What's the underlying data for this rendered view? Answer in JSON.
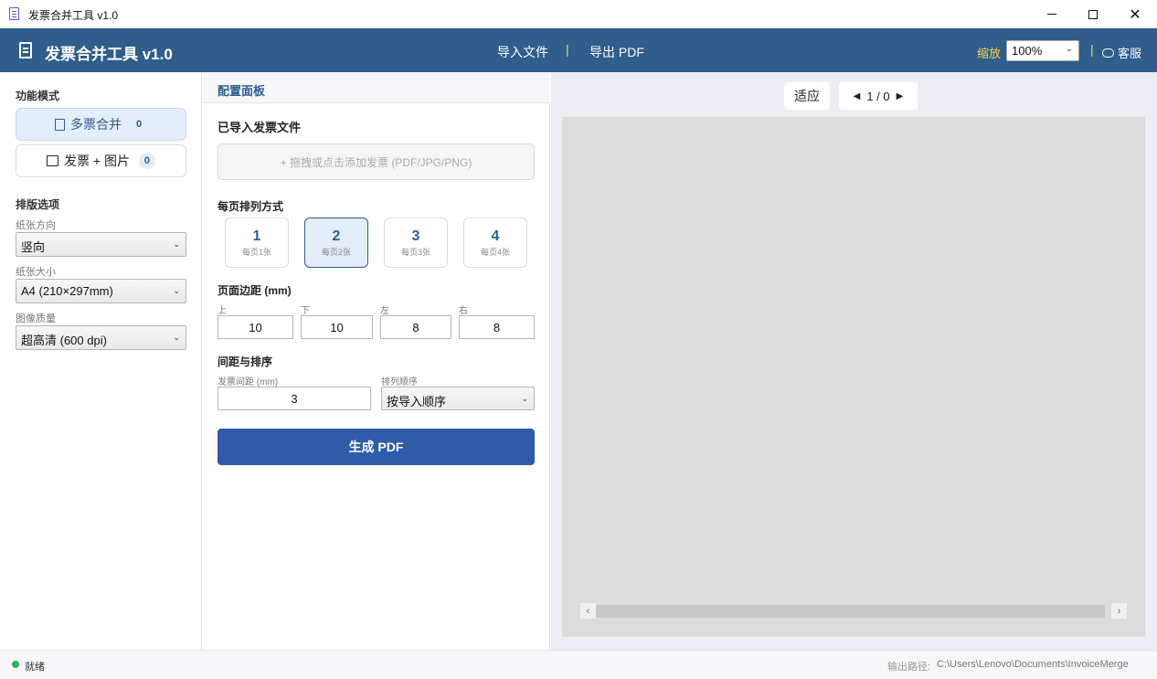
{
  "window": {
    "title": "发票合并工具 v1.0"
  },
  "header": {
    "app_title": "发票合并工具 v1.0",
    "nav_import": "导入文件",
    "nav_separator": "|",
    "nav_export": "导出 PDF",
    "zoom_label": "缩放",
    "zoom_value": "100%",
    "support_label": "客服"
  },
  "sidebar": {
    "mode_title": "功能模式",
    "modes": [
      {
        "label": "多票合并",
        "count": "0",
        "active": true
      },
      {
        "label": "发票 + 图片",
        "count": "0",
        "active": false
      }
    ],
    "layout_title": "排版选项",
    "orientation_label": "纸张方向",
    "orientation_value": "竖向",
    "paper_label": "纸张大小",
    "paper_value": "A4 (210×297mm)",
    "quality_label": "图像质量",
    "quality_value": "超高清 (600 dpi)"
  },
  "config": {
    "panel_title": "配置面板",
    "imported_title": "已导入发票文件",
    "dropzone_text": "+ 拖拽或点击添加发票 (PDF/JPG/PNG)",
    "per_page_title": "每页排列方式",
    "layouts": [
      {
        "num": "1",
        "sub": "每页1张",
        "active": false
      },
      {
        "num": "2",
        "sub": "每页2张",
        "active": true
      },
      {
        "num": "3",
        "sub": "每页3张",
        "active": false
      },
      {
        "num": "4",
        "sub": "每页4张",
        "active": false
      }
    ],
    "margin_title": "页面边距 (mm)",
    "margins": [
      {
        "label": "上",
        "value": "10"
      },
      {
        "label": "下",
        "value": "10"
      },
      {
        "label": "左",
        "value": "8"
      },
      {
        "label": "右",
        "value": "8"
      }
    ],
    "spacing_title": "间距与排序",
    "gap_label": "发票间距 (mm)",
    "gap_value": "3",
    "order_label": "排列顺序",
    "order_value": "按导入顺序",
    "generate_label": "生成 PDF"
  },
  "preview": {
    "fit_label": "适应",
    "prev_arrow": "◀",
    "page_indicator": "1 / 0",
    "next_arrow": "▶"
  },
  "status": {
    "state": "就绪",
    "output_label": "输出路径:",
    "output_path": "C:\\Users\\Lenovo\\Documents\\InvoiceMerge",
    "state_color": "#2fb35b"
  },
  "colors": {
    "brand": "#2f5d8c",
    "accent": "#2e5baa",
    "highlight": "#f3d54e"
  }
}
